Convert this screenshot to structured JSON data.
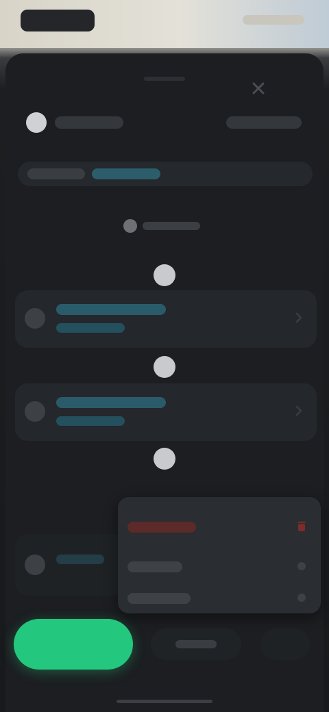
{
  "colors": {
    "accent_green": "#24c77e",
    "accent_teal": "#2a5b6a",
    "destructive_red": "#a83a36",
    "sheet_bg": "#1c1e21",
    "card_bg": "#24272b"
  },
  "icons": {
    "close": "close-icon",
    "avatar": "avatar",
    "section": "circle-icon",
    "card_leading": "circle-icon",
    "card_trailing": "chevron-right-icon",
    "menu_first": "delete-icon",
    "menu_other": "menu-item-icon"
  },
  "cards": [
    {
      "kind": "primary"
    },
    {
      "kind": "primary"
    }
  ],
  "menu": {
    "items": [
      {
        "kind": "destructive"
      },
      {
        "kind": "normal"
      },
      {
        "kind": "normal"
      }
    ]
  }
}
